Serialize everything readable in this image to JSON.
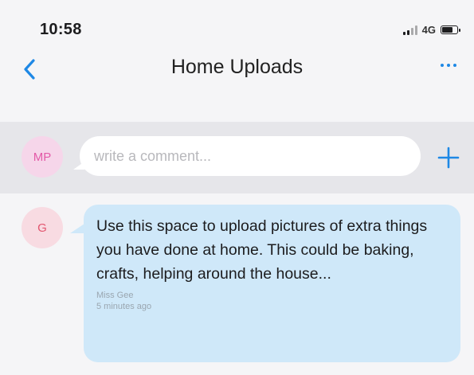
{
  "status_bar": {
    "time": "10:58",
    "network": "4G"
  },
  "nav": {
    "title": "Home Uploads"
  },
  "comment_bar": {
    "avatar_initials": "MP",
    "placeholder": "write a comment..."
  },
  "messages": [
    {
      "avatar_initials": "G",
      "text": "Use this space to upload pictures of extra things you have done at home. This could be baking, crafts, helping around the house...",
      "author": "Miss Gee",
      "time": "5 minutes ago"
    }
  ],
  "colors": {
    "accent": "#1e88e5",
    "bubble": "#cfe8f9",
    "avatar_mp_bg": "#f6d6ea",
    "avatar_g_bg": "#f8dbe2"
  },
  "icons": {
    "back": "chevron-left-icon",
    "more": "ellipsis-icon",
    "add": "plus-icon"
  }
}
